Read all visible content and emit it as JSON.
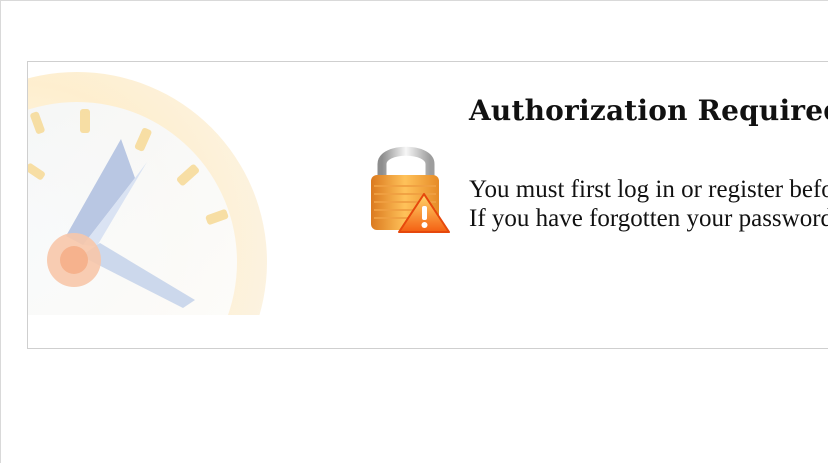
{
  "notice": {
    "title": "Authorization Required",
    "lines": [
      "You must first log in or register before you can do that.",
      "If you have forgotten your password, you can reset it."
    ]
  },
  "icons": {
    "watermark": "clock-watermark-icon",
    "lock": "padlock-warning-icon"
  },
  "colors": {
    "border": "#cfcfcf",
    "watermark": "#f9dfa5",
    "lock": "#f0a12f",
    "warning": "#ff8a1f"
  }
}
